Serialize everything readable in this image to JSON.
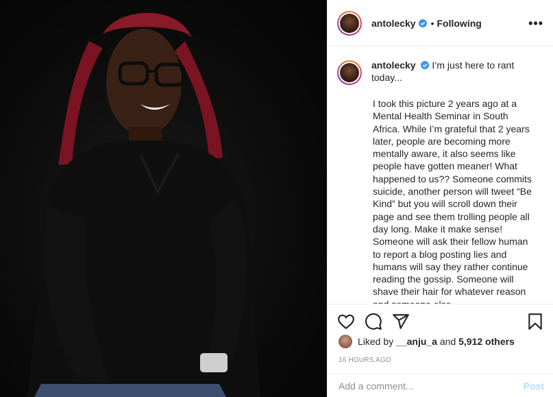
{
  "post": {
    "username": "antolecky",
    "separator": "•",
    "follow_status": "Following",
    "more_label": "•••"
  },
  "caption": {
    "username": "antolecky",
    "first_line": "I’m just here to rant today...",
    "body": "I took this picture 2 years ago at a Mental Health Seminar in South Africa. While I’m grateful that 2 years later, people are becoming more mentally aware, it also seems like people have gotten meaner! What happened to us?? Someone commits suicide, another person will tweet “Be Kind” but you will scroll down their page and see them trolling people all day long. Make it make sense! Someone will ask their fellow human to report a blog posting lies and humans will say they rather continue reading the gossip. Someone will shave their hair for whatever reason and someone else"
  },
  "likes": {
    "prefix": "Liked by",
    "user": "__anju_a",
    "connector": "and",
    "others": "5,912 others"
  },
  "timestamp": "16 HOURS AGO",
  "comment_box": {
    "placeholder": "Add a comment...",
    "post_label": "Post"
  },
  "icons": [
    "heart-icon",
    "comment-icon",
    "share-icon",
    "bookmark-icon",
    "verified-badge-icon",
    "more-options-icon"
  ],
  "colors": {
    "verified": "#3897f0",
    "post_disabled": "#b2dffc",
    "muted": "#8e8e8e"
  }
}
